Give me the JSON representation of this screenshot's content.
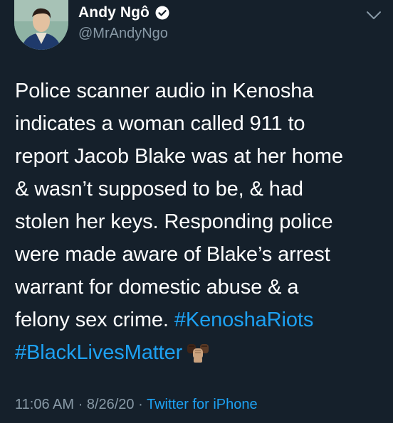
{
  "author": {
    "display_name": "Andy Ngô",
    "handle": "@MrAndyNgo",
    "verified": true
  },
  "tweet": {
    "text_lines": [
      "Police scanner audio in Kenosha",
      "indicates a woman called 911 to",
      "report Jacob Blake was at her home",
      "& wasn’t supposed to be, & had",
      "stolen her keys. Responding police",
      "were made aware of Blake’s arrest",
      "warrant for domestic abuse & a",
      "felony sex crime. "
    ],
    "hashtags": [
      "#KenoshaRiots",
      "#BlackLivesMatter"
    ],
    "emoji": "raised-fists-emoji"
  },
  "meta": {
    "time": "11:06 AM",
    "separator1": " · ",
    "date": "8/26/20",
    "separator2": " · ",
    "source": "Twitter for iPhone"
  },
  "colors": {
    "background": "#15202b",
    "text": "#ffffff",
    "secondary": "#8899a6",
    "link": "#1da1f2"
  },
  "icons": {
    "verified": "verified-badge-icon",
    "menu": "chevron-down-icon"
  }
}
